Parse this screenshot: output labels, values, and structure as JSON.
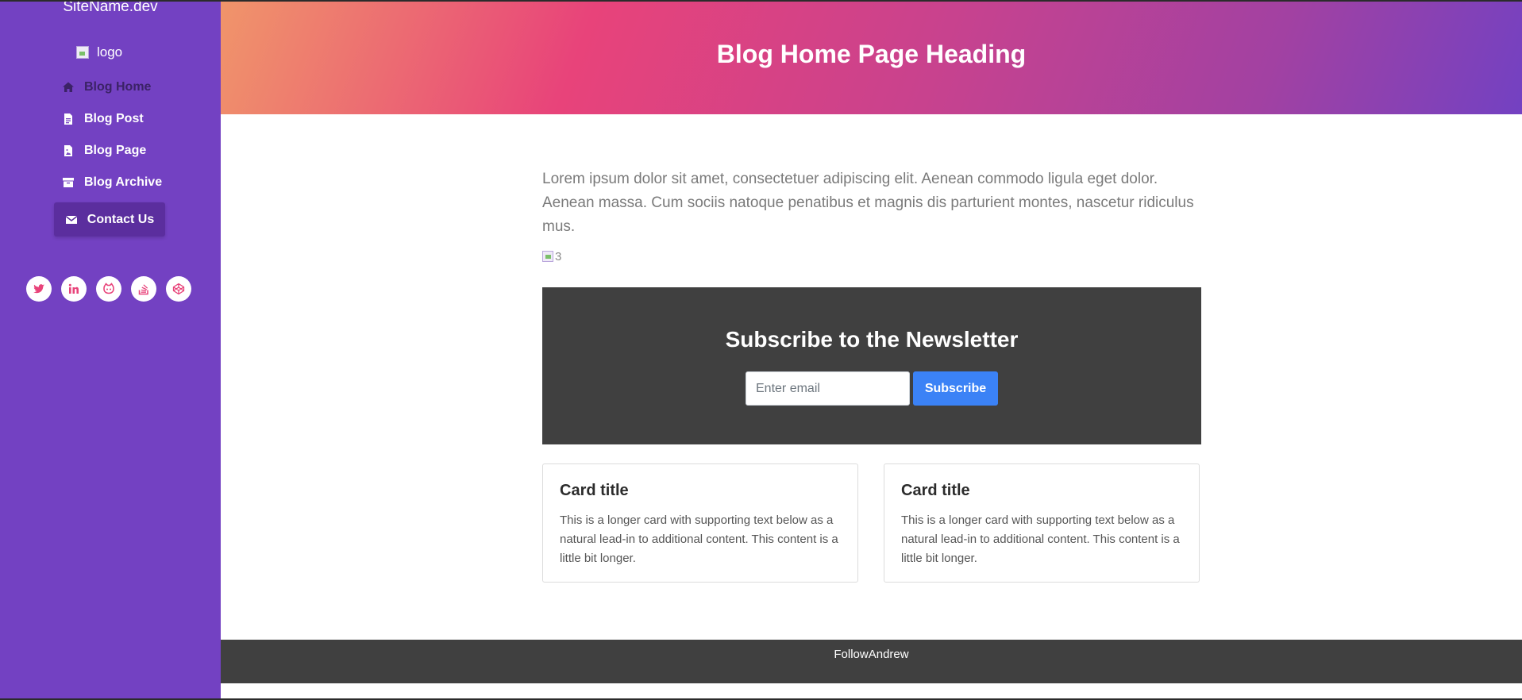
{
  "sidebar": {
    "site_name": "SiteName.dev",
    "logo_alt": "logo",
    "nav": [
      {
        "label": "Blog Home",
        "icon": "home-icon"
      },
      {
        "label": "Blog Post",
        "icon": "file-text-icon"
      },
      {
        "label": "Blog Page",
        "icon": "file-image-icon"
      },
      {
        "label": "Blog Archive",
        "icon": "archive-icon"
      }
    ],
    "contact": {
      "label": "Contact Us",
      "icon": "envelope-icon"
    },
    "socials": [
      "twitter-icon",
      "linkedin-icon",
      "github-icon",
      "stackoverflow-icon",
      "codepen-icon"
    ]
  },
  "header": {
    "title": "Blog Home Page Heading"
  },
  "main": {
    "intro": "Lorem ipsum dolor sit amet, consectetuer adipiscing elit. Aenean commodo ligula eget dolor. Aenean massa. Cum sociis natoque penatibus et magnis dis parturient montes, nascetur ridiculus mus.",
    "image_alt": "3",
    "newsletter": {
      "title": "Subscribe to the Newsletter",
      "email_placeholder": "Enter email",
      "button_label": "Subscribe"
    },
    "cards": [
      {
        "title": "Card title",
        "text": "This is a longer card with supporting text below as a natural lead-in to additional content. This content is a little bit longer."
      },
      {
        "title": "Card title",
        "text": "This is a longer card with supporting text below as a natural lead-in to additional content. This content is a little bit longer."
      }
    ]
  },
  "footer": {
    "text": "FollowAndrew"
  },
  "colors": {
    "sidebar": "#7341c2",
    "active_nav": "#3b2266",
    "contact_bg": "#5b2e9e",
    "accent_pink": "#e8437a",
    "newsletter_bg": "#404040",
    "subscribe_btn": "#3b82f6"
  }
}
